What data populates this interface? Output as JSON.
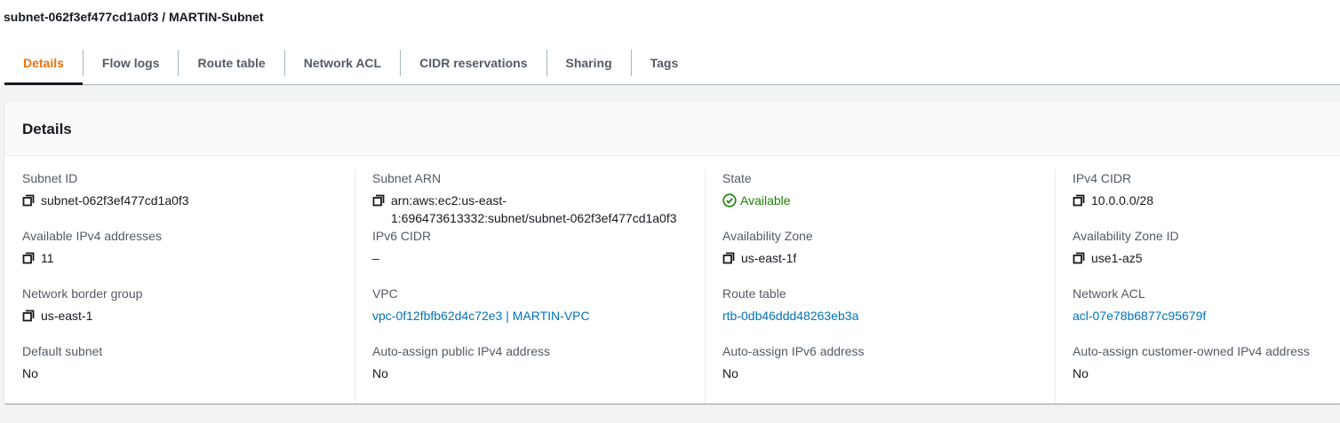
{
  "page": {
    "title": "subnet-062f3ef477cd1a0f3 / MARTIN-Subnet"
  },
  "tabs": [
    {
      "label": "Details",
      "active": true
    },
    {
      "label": "Flow logs"
    },
    {
      "label": "Route table"
    },
    {
      "label": "Network ACL"
    },
    {
      "label": "CIDR reservations"
    },
    {
      "label": "Sharing"
    },
    {
      "label": "Tags"
    }
  ],
  "panel": {
    "title": "Details",
    "columns": [
      [
        {
          "label": "Subnet ID",
          "value": "subnet-062f3ef477cd1a0f3",
          "copy": true
        },
        {
          "label": "Available IPv4 addresses",
          "value": "11",
          "copy": true
        },
        {
          "label": "Network border group",
          "value": "us-east-1",
          "copy": true
        },
        {
          "label": "Default subnet",
          "value": "No"
        }
      ],
      [
        {
          "label": "Subnet ARN",
          "value": "arn:aws:ec2:us-east-\n1:696473613332:subnet/subnet-062f3ef477cd1a0f3",
          "copy": true
        },
        {
          "label": "IPv6 CIDR",
          "value": "–"
        },
        {
          "label": "VPC",
          "value": "vpc-0f12fbfb62d4c72e3 | MARTIN-VPC",
          "link": true
        },
        {
          "label": "Auto-assign public IPv4 address",
          "value": "No"
        }
      ],
      [
        {
          "label": "State",
          "value": "Available",
          "status": "success"
        },
        {
          "label": "Availability Zone",
          "value": "us-east-1f",
          "copy": true
        },
        {
          "label": "Route table",
          "value": "rtb-0db46ddd48263eb3a",
          "link": true
        },
        {
          "label": "Auto-assign IPv6 address",
          "value": "No"
        }
      ],
      [
        {
          "label": "IPv4 CIDR",
          "value": "10.0.0.0/28",
          "copy": true
        },
        {
          "label": "Availability Zone ID",
          "value": "use1-az5",
          "copy": true
        },
        {
          "label": "Network ACL",
          "value": "acl-07e78b6877c95679f",
          "link": true
        },
        {
          "label": "Auto-assign customer-owned IPv4 address",
          "value": "No"
        }
      ]
    ]
  },
  "icons": {
    "copy": "copy-icon",
    "status_success": "status-success-icon"
  },
  "colors": {
    "accent_active_tab": "#ec7211",
    "link": "#0073bb",
    "success": "#1d8102",
    "text": "#16191f",
    "muted": "#545b64"
  }
}
